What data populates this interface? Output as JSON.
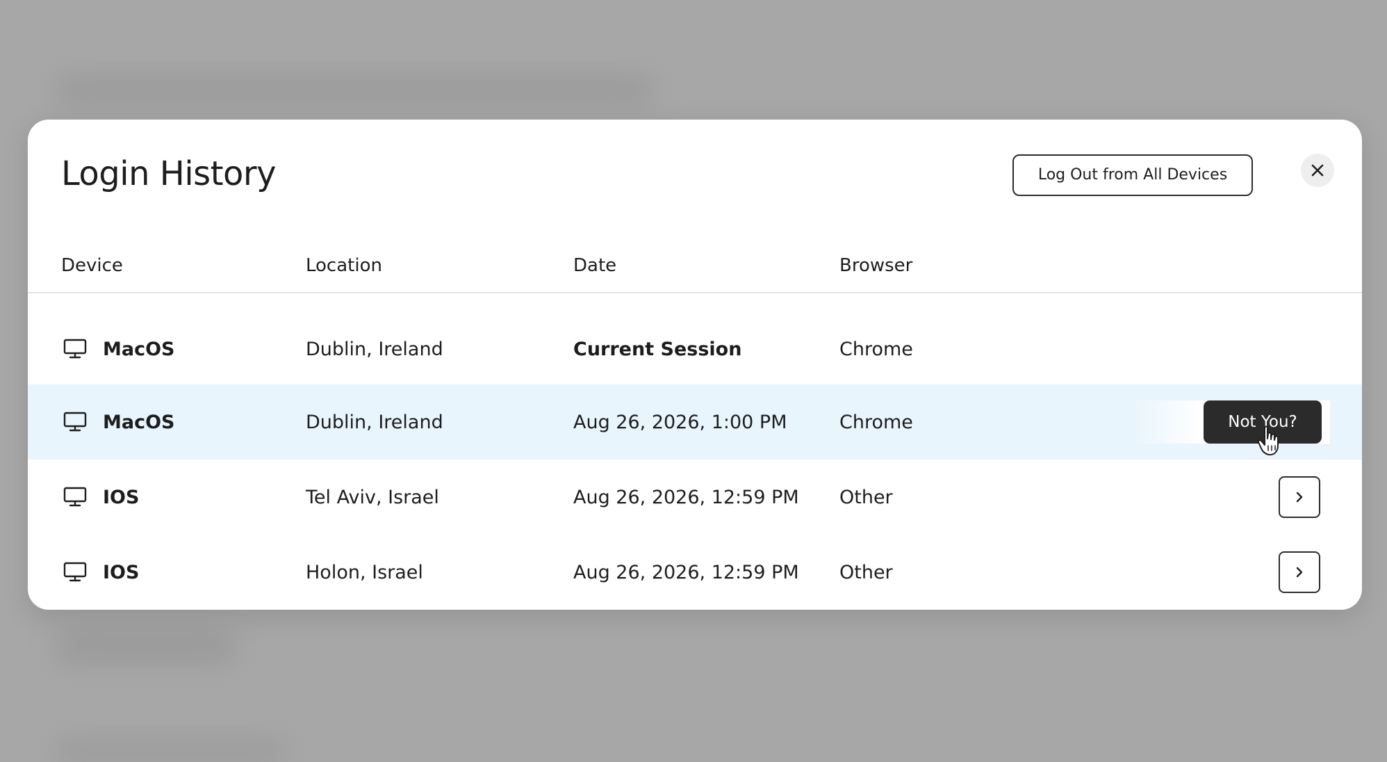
{
  "modal": {
    "title": "Login History",
    "logout_all_label": "Log Out from All Devices",
    "close_icon": "close-icon"
  },
  "table": {
    "columns": [
      "Device",
      "Location",
      "Date",
      "Browser"
    ],
    "rows": [
      {
        "device": "MacOS",
        "location": "Dublin, Ireland",
        "date": "Current Session",
        "browser": "Chrome",
        "icon": "desktop-icon"
      },
      {
        "device": "MacOS",
        "location": "Dublin, Ireland",
        "date": "Aug 26, 2026, 1:00 PM",
        "browser": "Chrome",
        "icon": "desktop-icon",
        "action_label": "Not You?"
      },
      {
        "device": "IOS",
        "location": "Tel Aviv, Israel",
        "date": "Aug 26, 2026, 12:59 PM",
        "browser": "Other",
        "icon": "desktop-icon",
        "action_icon": "chevron-right-icon"
      },
      {
        "device": "IOS",
        "location": "Holon, Israel",
        "date": "Aug 26, 2026, 12:59 PM",
        "browser": "Other",
        "icon": "desktop-icon",
        "action_icon": "chevron-right-icon"
      }
    ]
  },
  "colors": {
    "backdrop": "#a7a7a7",
    "highlight_row": "#e8f5fc",
    "dark_button": "#2b2b2b"
  }
}
